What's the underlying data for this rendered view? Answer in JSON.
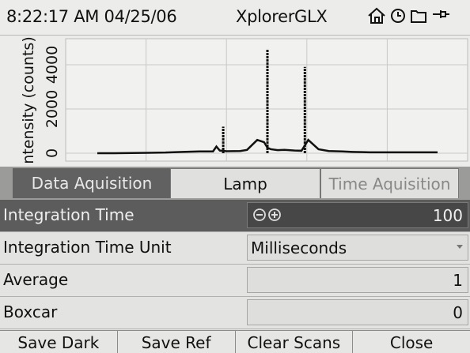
{
  "status": {
    "time": "8:22:17 AM",
    "date": "04/25/06",
    "title": "XplorerGLX",
    "icons": [
      "home-icon",
      "clock-icon",
      "folder-icon",
      "power-icon"
    ]
  },
  "chart_data": {
    "type": "line",
    "ylabel": "ntensity (counts)",
    "yticks": [
      "0",
      "2000",
      "4000"
    ],
    "ylim": [
      0,
      5000
    ],
    "xlim": [
      0,
      100
    ],
    "grid": true,
    "series": [
      {
        "x": [
          0,
          5,
          15,
          20,
          25,
          30,
          34,
          35,
          36,
          38,
          42,
          44,
          47,
          49,
          50,
          51,
          53,
          55,
          58,
          60,
          62,
          65,
          68,
          72,
          75,
          78,
          80,
          100
        ],
        "values": [
          0,
          0,
          20,
          30,
          60,
          80,
          80,
          300,
          120,
          90,
          100,
          150,
          600,
          500,
          250,
          180,
          140,
          150,
          120,
          110,
          600,
          180,
          100,
          80,
          60,
          50,
          40,
          40
        ]
      }
    ],
    "spikes": [
      {
        "x": 37,
        "y": 1200
      },
      {
        "x": 50,
        "y": 4700
      },
      {
        "x": 61,
        "y": 3900
      }
    ]
  },
  "tabs": [
    {
      "label": "Data Aquisition",
      "state": "active"
    },
    {
      "label": "Lamp",
      "state": "normal"
    },
    {
      "label": "Time Aquisition",
      "state": "disabled"
    }
  ],
  "rows": [
    {
      "label": "Integration Time",
      "value": "100",
      "kind": "stepper"
    },
    {
      "label": "Integration Time Unit",
      "value": "Milliseconds",
      "kind": "dropdown"
    },
    {
      "label": "Average",
      "value": "1",
      "kind": "number"
    },
    {
      "label": "Boxcar",
      "value": "0",
      "kind": "number"
    }
  ],
  "softkeys": [
    "Save Dark",
    "Save Ref",
    "Clear Scans",
    "Close"
  ]
}
